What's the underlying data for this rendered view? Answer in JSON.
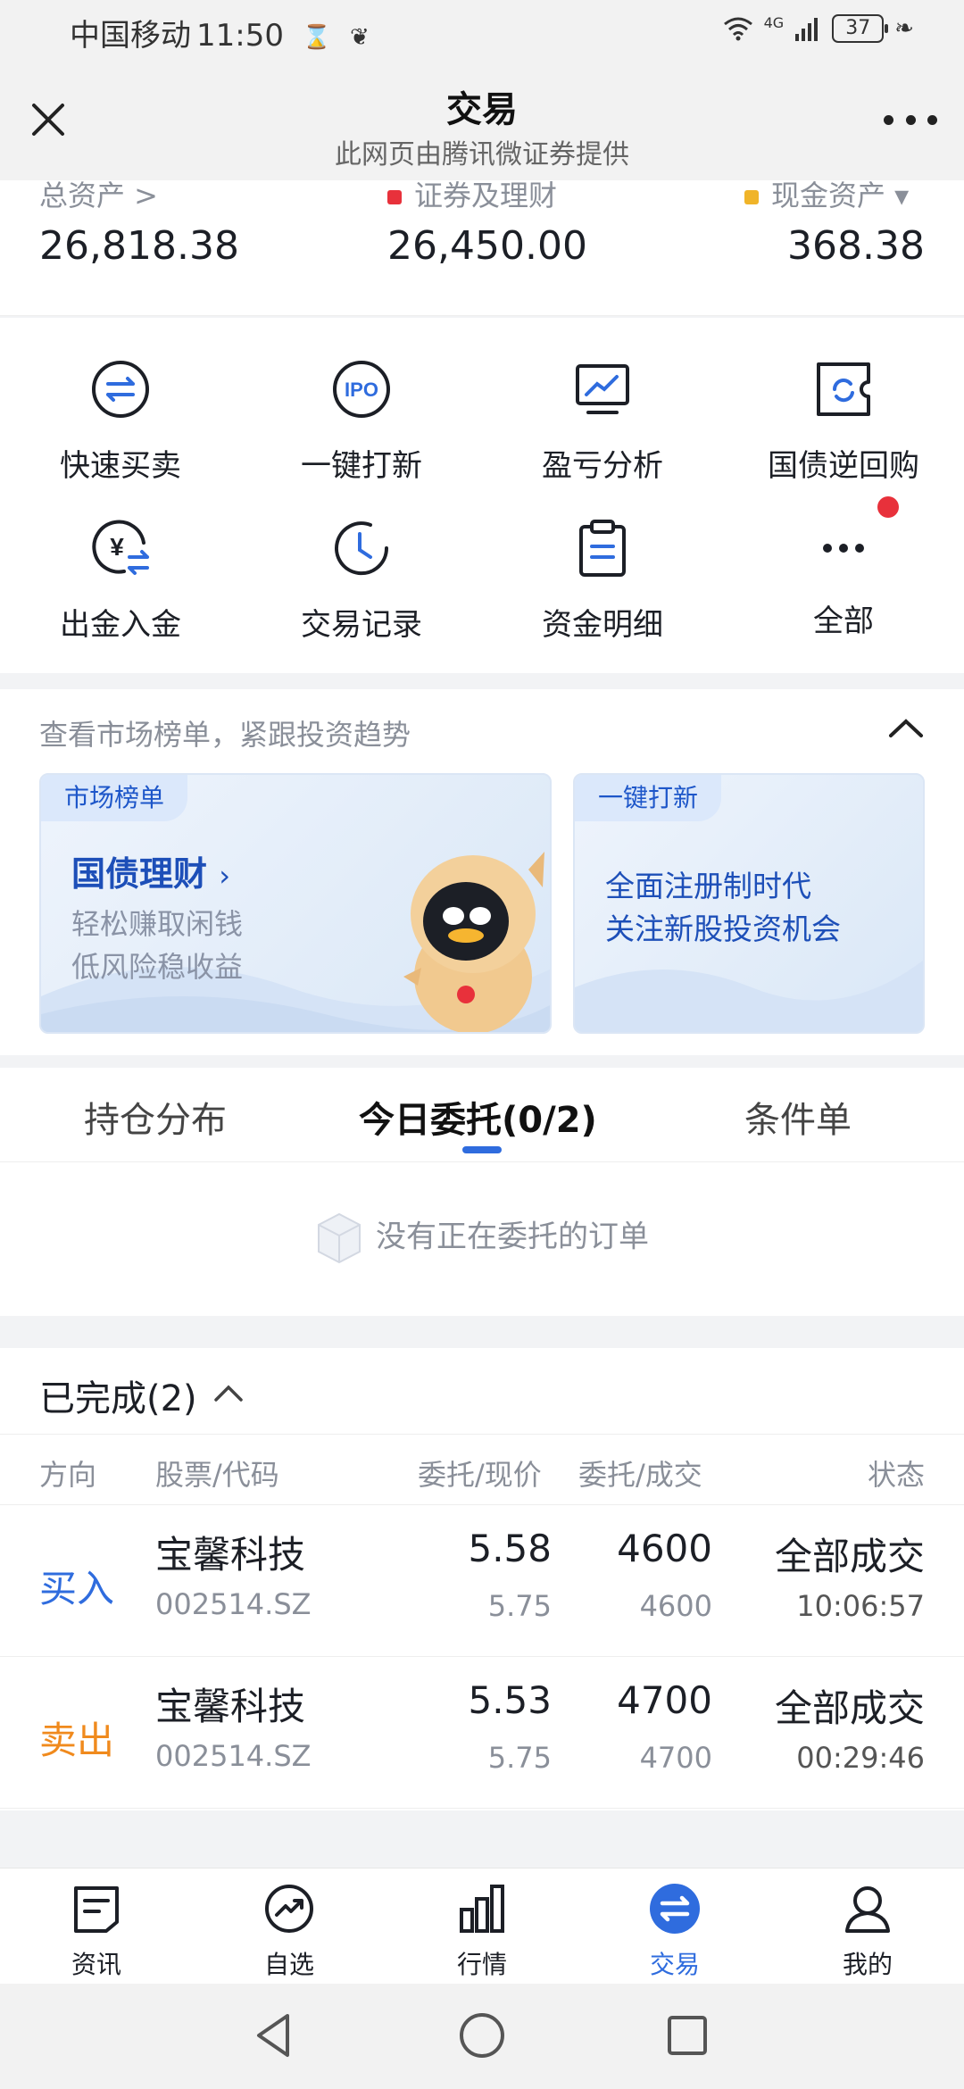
{
  "status_bar": {
    "carrier": "中国移动",
    "time": "11:50",
    "network": "4G",
    "battery": "37"
  },
  "titlebar": {
    "title": "交易",
    "subtitle": "此网页由腾讯微证券提供"
  },
  "assets": {
    "total_label": "总资产 >",
    "securities_label": "证券及理财",
    "cash_label": "现金资产 ▾",
    "total_value": "26,818.38",
    "securities_value": "26,450.00",
    "cash_value": "368.38",
    "securities_color": "#e8313b",
    "cash_color": "#f0b429"
  },
  "quick_actions": [
    {
      "label": "快速买卖",
      "icon": "swap-icon"
    },
    {
      "label": "一键打新",
      "icon": "ipo-icon"
    },
    {
      "label": "盈亏分析",
      "icon": "chart-monitor-icon"
    },
    {
      "label": "国债逆回购",
      "icon": "refresh-ticket-icon"
    },
    {
      "label": "出金入金",
      "icon": "yuan-transfer-icon"
    },
    {
      "label": "交易记录",
      "icon": "clock-icon"
    },
    {
      "label": "资金明细",
      "icon": "clipboard-icon"
    },
    {
      "label": "全部",
      "icon": "more-dots-icon"
    }
  ],
  "market": {
    "heading": "查看市场榜单，紧跟投资趋势",
    "card1": {
      "tag": "市场榜单",
      "title": "国债理财",
      "line1": "轻松赚取闲钱",
      "line2": "低风险稳收益"
    },
    "card2": {
      "tag": "一键打新",
      "line1": "全面注册制时代",
      "line2": "关注新股投资机会"
    }
  },
  "orders": {
    "tabs": [
      "持仓分布",
      "今日委托(0/2)",
      "条件单"
    ],
    "empty_text": "没有正在委托的订单"
  },
  "completed": {
    "heading": "已完成(2)",
    "columns": [
      "方向",
      "股票/代码",
      "委托/现价",
      "委托/成交",
      "状态"
    ],
    "rows": [
      {
        "direction": "买入",
        "name": "宝馨科技",
        "code": "002514.SZ",
        "order_price": "5.58",
        "current_price": "5.75",
        "order_qty": "4600",
        "filled_qty": "4600",
        "status": "全部成交",
        "time": "10:06:57"
      },
      {
        "direction": "卖出",
        "name": "宝馨科技",
        "code": "002514.SZ",
        "order_price": "5.53",
        "current_price": "5.75",
        "order_qty": "4700",
        "filled_qty": "4700",
        "status": "全部成交",
        "time": "00:29:46"
      }
    ]
  },
  "bottom_nav": [
    {
      "label": "资讯",
      "icon": "news-icon"
    },
    {
      "label": "自选",
      "icon": "trend-icon"
    },
    {
      "label": "行情",
      "icon": "bar-chart-icon"
    },
    {
      "label": "交易",
      "icon": "trade-icon",
      "active": true
    },
    {
      "label": "我的",
      "icon": "user-icon"
    }
  ],
  "colors": {
    "accent": "#2f6cde",
    "buy": "#2f6cde",
    "sell": "#f08a1d"
  }
}
